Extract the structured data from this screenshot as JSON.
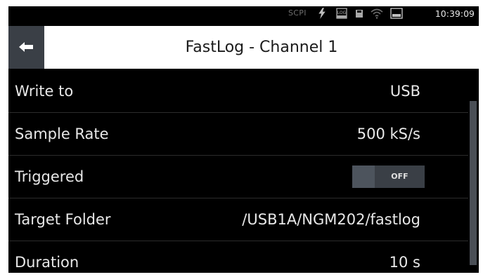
{
  "status_bar": {
    "scpi_label": "SCPI",
    "icons": [
      "lightning-icon",
      "log-icon",
      "usb-drive-icon",
      "wifi-icon",
      "screen-icon"
    ],
    "time": "10:39:09"
  },
  "header": {
    "back_icon": "arrow-left-icon",
    "title": "FastLog - Channel 1"
  },
  "settings": {
    "write_to": {
      "label": "Write to",
      "value": "USB"
    },
    "sample_rate": {
      "label": "Sample Rate",
      "value": "500 kS/s"
    },
    "triggered": {
      "label": "Triggered",
      "toggle_text": "OFF",
      "enabled": false
    },
    "target_folder": {
      "label": "Target Folder",
      "value": "/USB1A/NGM202/fastlog"
    },
    "duration": {
      "label": "Duration",
      "value": "10 s"
    }
  },
  "colors": {
    "background": "#000000",
    "header_bg": "#ffffff",
    "button_bg": "#3a3f46",
    "text": "#e8e8e8"
  }
}
